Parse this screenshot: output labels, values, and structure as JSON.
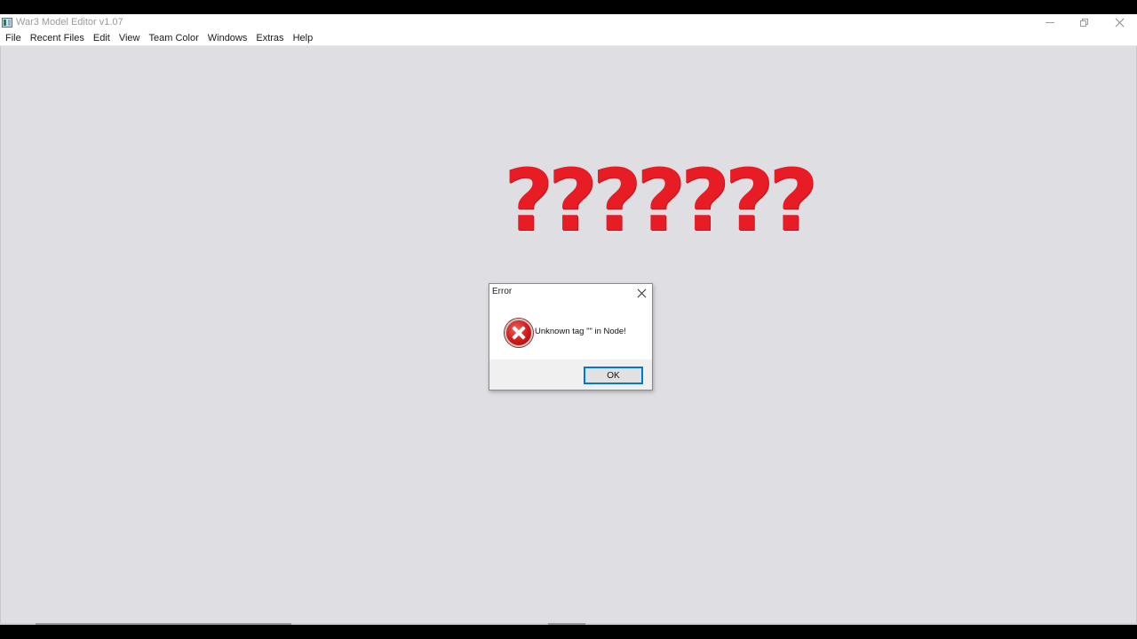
{
  "window": {
    "title": "War3 Model Editor v1.07"
  },
  "menu": {
    "items": [
      {
        "label": "File"
      },
      {
        "label": "Recent Files"
      },
      {
        "label": "Edit"
      },
      {
        "label": "View"
      },
      {
        "label": "Team Color"
      },
      {
        "label": "Windows"
      },
      {
        "label": "Extras"
      },
      {
        "label": "Help"
      }
    ]
  },
  "overlay": {
    "text": "???????",
    "color": "#e81c25"
  },
  "dialog": {
    "title": "Error",
    "message": "Unknown tag \"\" in Node!",
    "ok_label": "OK",
    "icon": "error-icon"
  },
  "colors": {
    "background": "#dfdee3",
    "accent": "#0078d7"
  }
}
